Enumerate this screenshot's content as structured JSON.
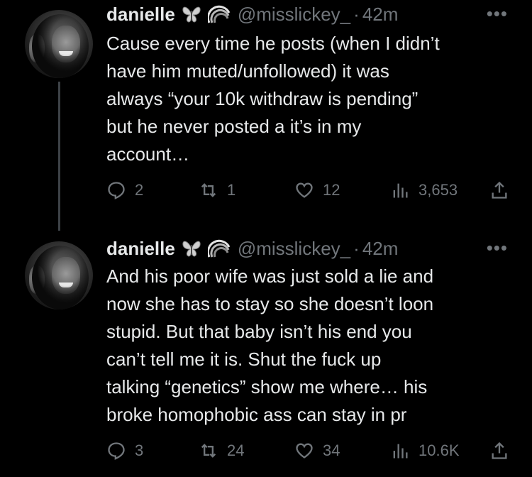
{
  "thread": {
    "tweets": [
      {
        "display_name": "danielle",
        "handle": "@misslickey_",
        "separator": "·",
        "time": "42m",
        "text": "Cause every time he posts (when I didn’t\nhave him muted/unfollowed) it was\nalways “your 10k withdraw is pending”\nbut he never posted a it’s in my\naccount…",
        "replies": "2",
        "retweets": "1",
        "likes": "12",
        "views": "3,653"
      },
      {
        "display_name": "danielle",
        "handle": "@misslickey_",
        "separator": "·",
        "time": "42m",
        "text": "And his poor wife was just sold a lie and\nnow she has to stay so she doesn’t loon\nstupid. But that baby isn’t his end you\ncan’t tell me it is. Shut the fuck up\ntalking “genetics” show me where… his\nbroke homophobic ass can stay in pr",
        "replies": "3",
        "retweets": "24",
        "likes": "34",
        "views": "10.6K"
      }
    ]
  },
  "more_label": "•••",
  "icons": {
    "badge_1": "butterfly-icon",
    "badge_2": "rainbow-icon",
    "reply": "reply-icon",
    "retweet": "retweet-icon",
    "like": "heart-icon",
    "views": "views-icon",
    "share": "share-icon"
  },
  "colors": {
    "background": "#000000",
    "text": "#e7e9ea",
    "secondary": "#71767b",
    "thread_line": "#3d4247"
  }
}
